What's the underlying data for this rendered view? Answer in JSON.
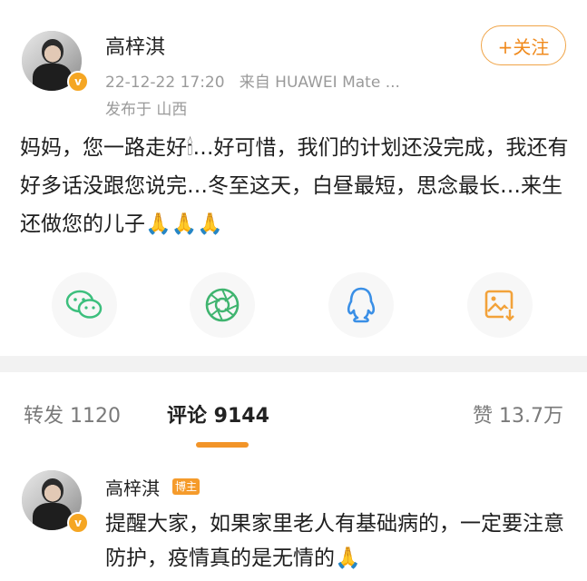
{
  "post": {
    "author": "高梓淇",
    "time": "22-12-22 17:20",
    "source": "来自 HUAWEI Mate ...",
    "location": "发布于 山西",
    "follow_label": "+关注",
    "content": "妈妈，您一路走好🕯…好可惜，我们的计划还没完成，我还有好多话没跟您说完…冬至这天，白昼最短，思念最长…来生还做您的儿子🙏🙏🙏"
  },
  "share": {
    "items": [
      {
        "icon": "wechat-icon"
      },
      {
        "icon": "moments-icon"
      },
      {
        "icon": "qq-icon"
      },
      {
        "icon": "save-image-icon"
      }
    ]
  },
  "tabs": {
    "repost": "转发 1120",
    "comment": "评论 9144",
    "like": "赞 13.7万"
  },
  "comment": {
    "author": "高梓淇",
    "tag": "博主",
    "text": "提醒大家，如果家里老人有基础病的，一定要注意防护，疫情真的是无情的🙏"
  },
  "colors": {
    "accent": "#f29428",
    "verified": "#f5a623",
    "wechat": "#3cbf7d",
    "moments": "#3fb46f",
    "qq": "#3a8fe6",
    "save": "#f2a23a"
  }
}
